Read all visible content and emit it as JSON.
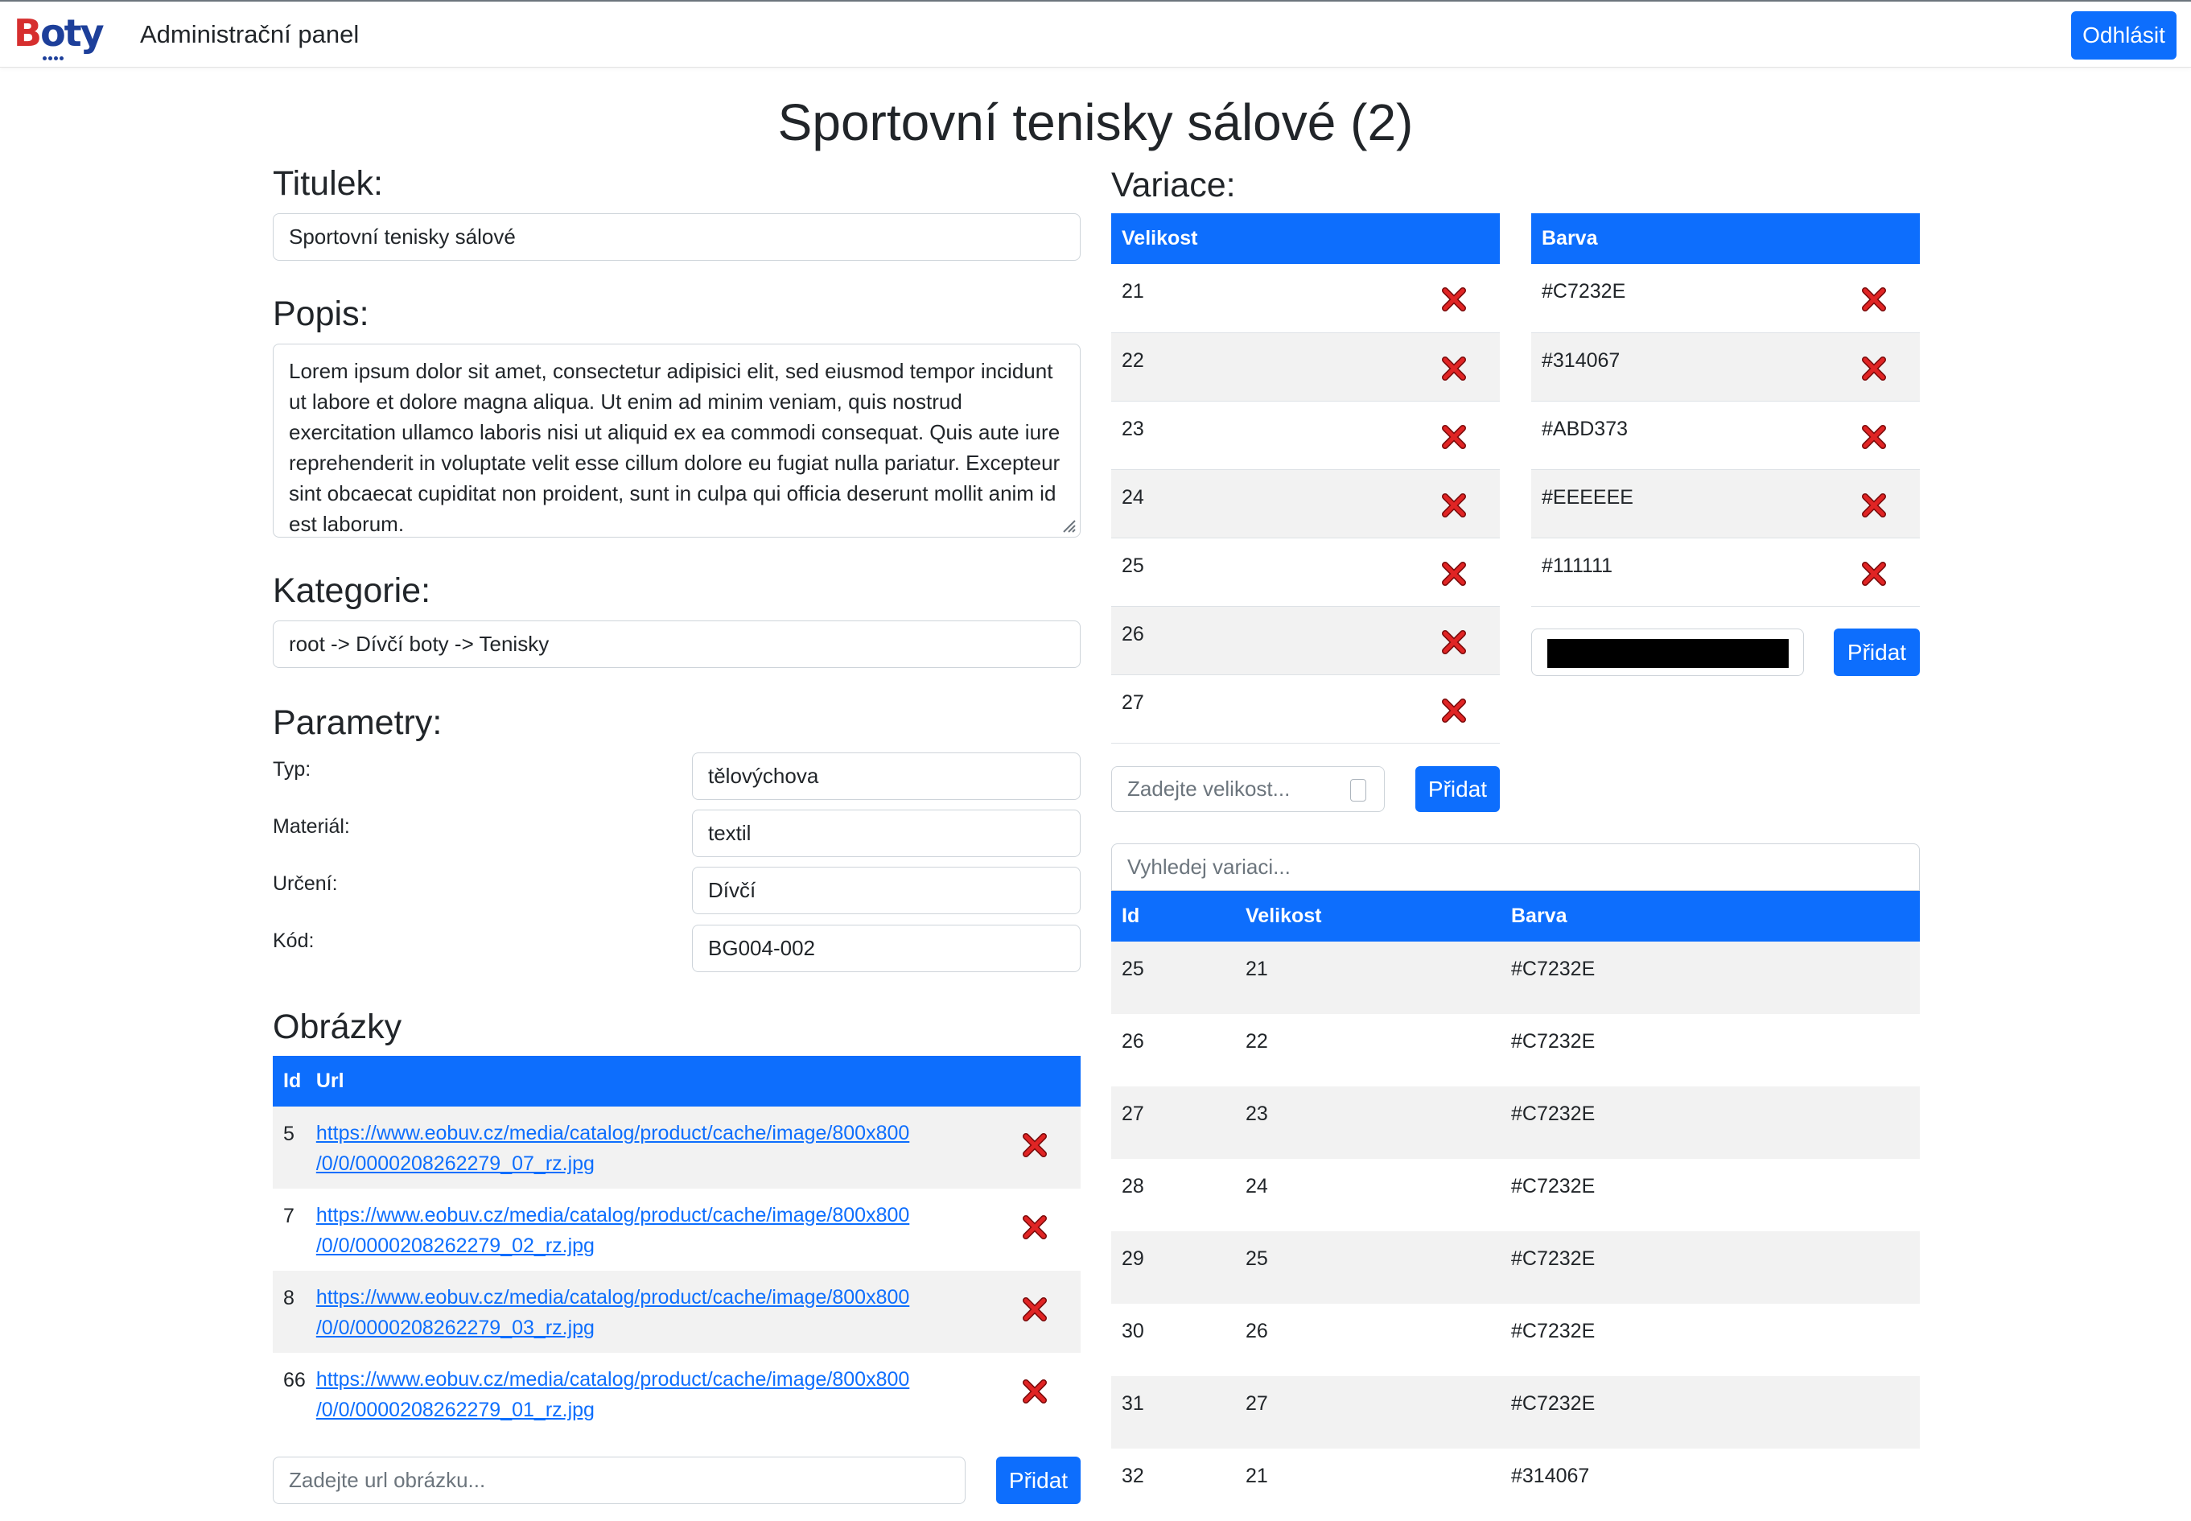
{
  "navbar": {
    "logo_first": "B",
    "logo_rest": "oty",
    "title": "Administrační panel",
    "logout_label": "Odhlásit"
  },
  "page": {
    "title": "Sportovní tenisky sálové (2)"
  },
  "form": {
    "title_label": "Titulek:",
    "title_value": "Sportovní tenisky sálové",
    "desc_label": "Popis:",
    "desc_value": "Lorem ipsum dolor sit amet, consectetur adipisici elit, sed eiusmod tempor incidunt ut labore et dolore magna aliqua. Ut enim ad minim veniam, quis nostrud exercitation ullamco laboris nisi ut aliquid ex ea commodi consequat. Quis aute iure reprehenderit in voluptate velit esse cillum dolore eu fugiat nulla pariatur. Excepteur sint obcaecat cupiditat non proident, sunt in culpa qui officia deserunt mollit anim id est laborum.",
    "category_label": "Kategorie:",
    "category_value": "root -> Dívčí boty -> Tenisky",
    "params_label": "Parametry:",
    "params": [
      {
        "label": "Typ:",
        "value": "tělovýchova"
      },
      {
        "label": "Materiál:",
        "value": "textil"
      },
      {
        "label": "Určení:",
        "value": "Dívčí"
      },
      {
        "label": "Kód:",
        "value": "BG004-002"
      }
    ]
  },
  "images": {
    "heading": "Obrázky",
    "col_id": "Id",
    "col_url": "Url",
    "rows": [
      {
        "id": "5",
        "url1": "https://www.eobuv.cz/media/catalog/product/cache/image/800x800",
        "url2": "/0/0/0000208262279_07_rz.jpg"
      },
      {
        "id": "7",
        "url1": "https://www.eobuv.cz/media/catalog/product/cache/image/800x800",
        "url2": "/0/0/0000208262279_02_rz.jpg"
      },
      {
        "id": "8",
        "url1": "https://www.eobuv.cz/media/catalog/product/cache/image/800x800",
        "url2": "/0/0/0000208262279_03_rz.jpg"
      },
      {
        "id": "66",
        "url1": "https://www.eobuv.cz/media/catalog/product/cache/image/800x800",
        "url2": "/0/0/0000208262279_01_rz.jpg"
      }
    ],
    "url_placeholder": "Zadejte url obrázku...",
    "add_label": "Přidat"
  },
  "variations": {
    "heading": "Variace:",
    "size_header": "Velikost",
    "sizes": [
      "21",
      "22",
      "23",
      "24",
      "25",
      "26",
      "27"
    ],
    "size_placeholder": "Zadejte velikost...",
    "size_add_label": "Přidat",
    "color_header": "Barva",
    "colors": [
      "#C7232E",
      "#314067",
      "#ABD373",
      "#EEEEEE",
      "#111111"
    ],
    "color_picker_value": "#000000",
    "color_add_label": "Přidat",
    "search_placeholder": "Vyhledej variaci...",
    "table_cols": {
      "id": "Id",
      "size": "Velikost",
      "color": "Barva"
    },
    "table_rows": [
      {
        "id": "25",
        "size": "21",
        "color": "#C7232E"
      },
      {
        "id": "26",
        "size": "22",
        "color": "#C7232E"
      },
      {
        "id": "27",
        "size": "23",
        "color": "#C7232E"
      },
      {
        "id": "28",
        "size": "24",
        "color": "#C7232E"
      },
      {
        "id": "29",
        "size": "25",
        "color": "#C7232E"
      },
      {
        "id": "30",
        "size": "26",
        "color": "#C7232E"
      },
      {
        "id": "31",
        "size": "27",
        "color": "#C7232E"
      },
      {
        "id": "32",
        "size": "21",
        "color": "#314067"
      }
    ]
  },
  "theme": {
    "primary": "#0d6efd",
    "delete_icon": "red-x-icon",
    "delete_color": "#d81b1b",
    "stripe": "#f2f2f2"
  }
}
